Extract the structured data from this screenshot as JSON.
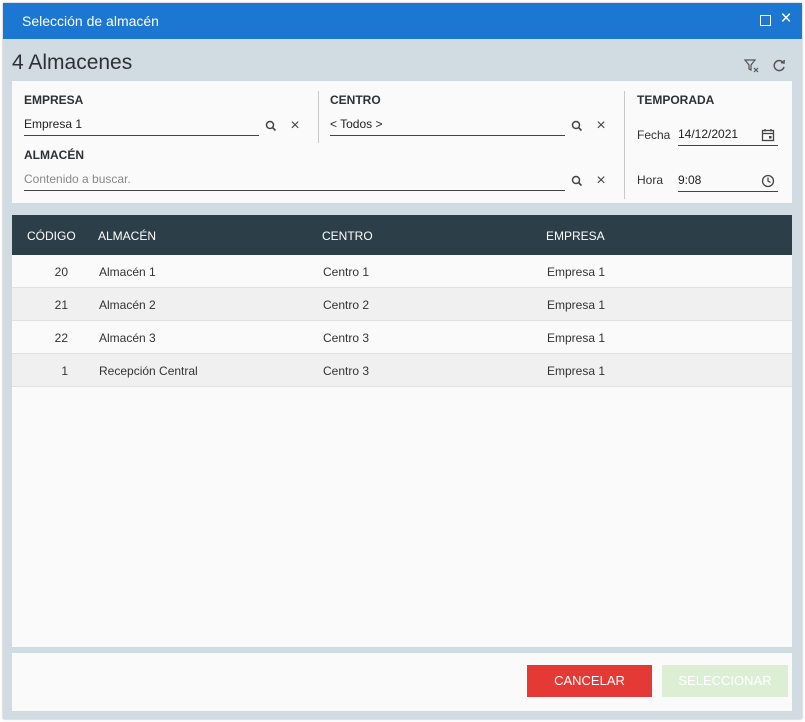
{
  "dialog": {
    "title": "Selección de almacén",
    "count_label": "4 Almacenes"
  },
  "filters": {
    "empresa": {
      "label": "EMPRESA",
      "value": "Empresa 1"
    },
    "centro": {
      "label": "CENTRO",
      "value": "< Todos >"
    },
    "almacen": {
      "label": "ALMACÉN",
      "placeholder": "Contenido a buscar."
    },
    "temporada": {
      "label": "TEMPORADA",
      "fecha_label": "Fecha",
      "fecha_value": "14/12/2021",
      "hora_label": "Hora",
      "hora_value": "9:08"
    }
  },
  "table": {
    "columns": [
      "CÓDIGO",
      "ALMACÉN",
      "CENTRO",
      "EMPRESA"
    ],
    "rows": [
      {
        "codigo": "20",
        "almacen": "Almacén 1",
        "centro": "Centro 1",
        "empresa": "Empresa 1"
      },
      {
        "codigo": "21",
        "almacen": "Almacén 2",
        "centro": "Centro 2",
        "empresa": "Empresa 1"
      },
      {
        "codigo": "22",
        "almacen": "Almacén 3",
        "centro": "Centro 3",
        "empresa": "Empresa 1"
      },
      {
        "codigo": "1",
        "almacen": "Recepción Central",
        "centro": "Centro 3",
        "empresa": "Empresa 1"
      }
    ]
  },
  "buttons": {
    "cancel": "CANCELAR",
    "select": "SELECCIONAR"
  },
  "colors": {
    "titlebar": "#1c77d2",
    "grid_header": "#2c3e47",
    "cancel": "#e53935",
    "select_disabled": "#dcefd4"
  }
}
